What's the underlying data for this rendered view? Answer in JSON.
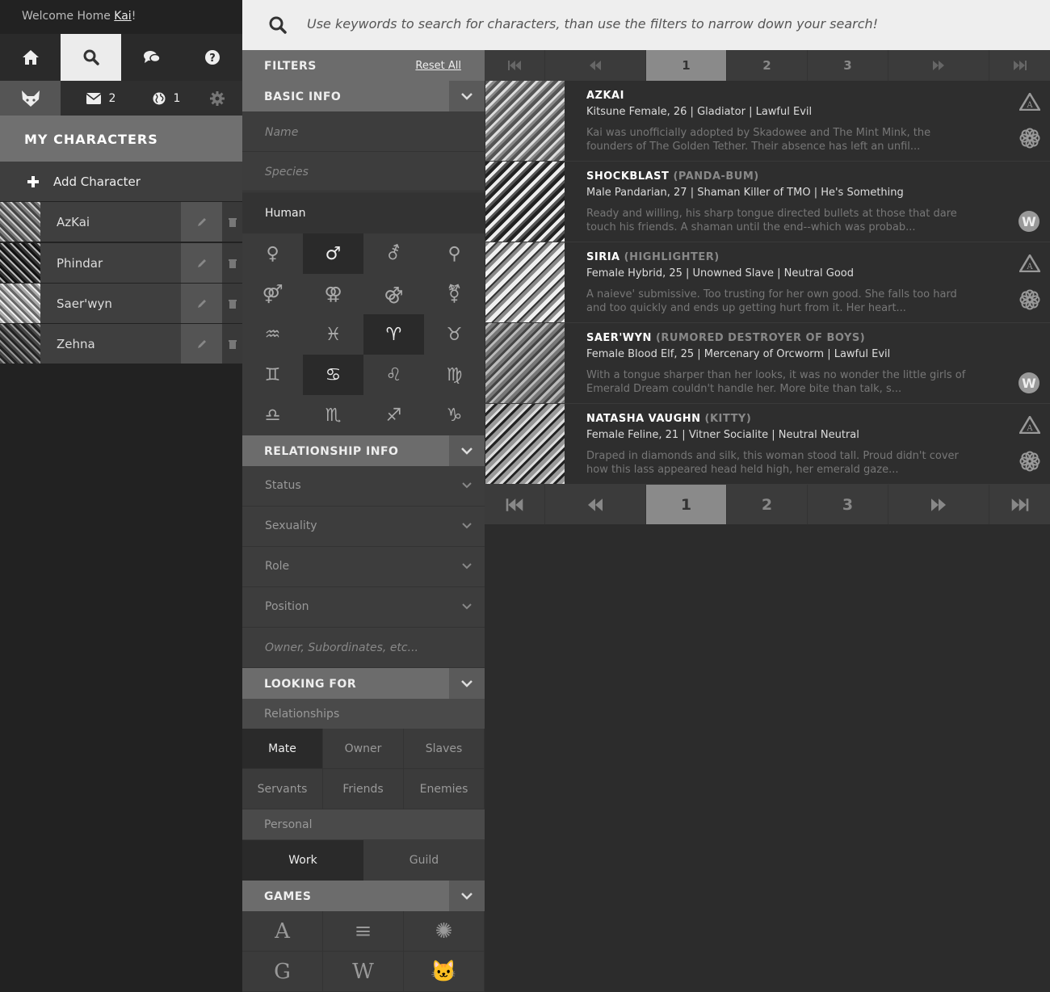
{
  "sidebar": {
    "welcome_prefix": "Welcome Home ",
    "username": "Kai",
    "welcome_suffix": "!",
    "messages_count": "2",
    "world_count": "1",
    "my_characters_title": "MY CHARACTERS",
    "add_character_label": "Add Character",
    "characters": [
      {
        "name": "AzKai"
      },
      {
        "name": "Phindar"
      },
      {
        "name": "Saer'wyn"
      },
      {
        "name": "Zehna"
      }
    ]
  },
  "search": {
    "placeholder": "Use keywords to search for characters, than use the filters to narrow down your search!"
  },
  "filters": {
    "title": "FILTERS",
    "reset_label": "Reset All",
    "basic_info": {
      "title": "BASIC INFO",
      "name_placeholder": "Name",
      "species_placeholder": "Species",
      "race_value": "Human",
      "gender_icons": [
        "♀",
        "♂",
        "⚦",
        "⚲",
        "⚤",
        "⚢",
        "⚣",
        "⚧"
      ],
      "zodiac_icons": [
        "♒",
        "♓",
        "♈",
        "♉",
        "♊",
        "♋",
        "♌",
        "♍",
        "♎",
        "♏",
        "♐",
        "♑"
      ]
    },
    "relationship_info": {
      "title": "RELATIONSHIP INFO",
      "status": "Status",
      "sexuality": "Sexuality",
      "role": "Role",
      "position": "Position",
      "owner_placeholder": "Owner, Subordinates, etc..."
    },
    "looking_for": {
      "title": "LOOKING FOR",
      "relationships_label": "Relationships",
      "relationships": [
        "Mate",
        "Owner",
        "Slaves",
        "Servants",
        "Friends",
        "Enemies"
      ],
      "personal_label": "Personal",
      "personal": [
        "Work",
        "Guild"
      ]
    },
    "games": {
      "title": "GAMES",
      "items": [
        "A",
        "≡",
        "✺",
        "G",
        "W",
        "🐱"
      ]
    }
  },
  "pager": {
    "pages": [
      "1",
      "2",
      "3"
    ],
    "current": "1"
  },
  "results": [
    {
      "name": "AZKAI",
      "nickname": "",
      "meta": "Kitsune Female, 26  |  Gladiator  |  Lawful Evil",
      "desc": "Kai was unofficially adopted by Skadowee and The Mint Mink, the founders of The Golden Tether. Their absence has left an unfil...",
      "game1": "archeage",
      "game2": "flower"
    },
    {
      "name": "SHOCKBLAST",
      "nickname": "(PANDA-BUM)",
      "meta": "Male Pandarian, 27  |  Shaman Killer of TMO  |  He's Something",
      "desc": "Ready and willing, his sharp tongue directed bullets at those that dare touch his friends. A shaman until the end--which was probab...",
      "game1": "",
      "game2": "wow"
    },
    {
      "name": "SIRIA",
      "nickname": "(HIGHLIGHTER)",
      "meta": "Female Hybrid, 25  |  Unowned Slave  |  Neutral Good",
      "desc": "A naieve' submissive. Too trusting for her own good. She falls too hard and too quickly and ends up getting hurt from it. Her heart...",
      "game1": "archeage",
      "game2": "flower"
    },
    {
      "name": "SAER'WYN",
      "nickname": "(RUMORED DESTROYER OF BOYS)",
      "meta": "Female Blood Elf, 25  |  Mercenary of Orcworm  |  Lawful Evil",
      "desc": "With a tongue sharper than her looks, it was no wonder the little girls of Emerald Dream couldn't handle her. More bite than talk, s...",
      "game1": "",
      "game2": "wow"
    },
    {
      "name": "NATASHA VAUGHN",
      "nickname": "(KITTY)",
      "meta": "Female Feline, 21  |  Vitner Socialite  |  Neutral Neutral",
      "desc": "Draped in diamonds and silk, this woman stood tall. Proud didn't cover how this lass appeared head held high, her emerald gaze...",
      "game1": "archeage",
      "game2": "flower"
    }
  ]
}
